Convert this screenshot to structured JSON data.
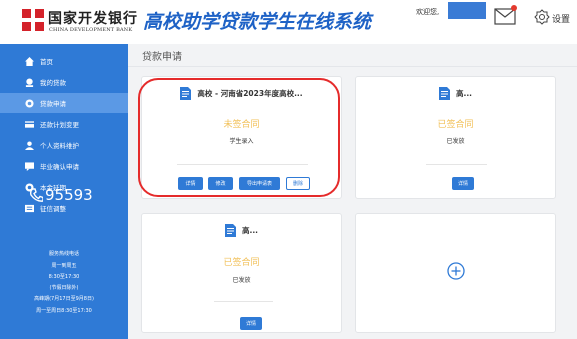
{
  "header": {
    "bank_name_cn": "国家开发银行",
    "bank_name_en": "CHINA DEVELOPMENT BANK",
    "system_title": "高校助学贷款学生在线系统",
    "welcome": "欢迎您,",
    "settings_label": "设置"
  },
  "sidebar": {
    "items": [
      {
        "label": "首页",
        "icon": "home-icon"
      },
      {
        "label": "我的贷款",
        "icon": "coin-icon"
      },
      {
        "label": "贷款申请",
        "icon": "apply-icon",
        "active": true
      },
      {
        "label": "还款计划变更",
        "icon": "card-icon"
      },
      {
        "label": "个人资料维护",
        "icon": "user-icon"
      },
      {
        "label": "毕业确认申请",
        "icon": "chat-icon"
      },
      {
        "label": "本金延期",
        "icon": "clock-icon"
      },
      {
        "label": "征信调整",
        "icon": "list-icon"
      }
    ],
    "hotline": "95593",
    "service_lines": [
      "服务热线电话",
      "周一到周五",
      "8:30至17:30",
      "(节假日除外)",
      "高峰期(7月17日至9月8日)",
      "周一至周日8:30至17:30"
    ]
  },
  "main": {
    "page_title": "贷款申请",
    "cards": [
      {
        "name": "高校 - 河南省2023年度高校...",
        "status": "未签合同",
        "sub_status": "学生录入",
        "buttons": [
          "详情",
          "修改",
          "导出申请表",
          "删除"
        ]
      },
      {
        "name": "高...",
        "status": "已签合同",
        "sub_status": "已发放",
        "buttons": [
          "详情"
        ]
      },
      {
        "name": "高...",
        "status": "已签合同",
        "sub_status": "已发放",
        "buttons": [
          "详情"
        ]
      }
    ]
  },
  "colors": {
    "primary": "#2f7ad6",
    "title_blue": "#1e62c6",
    "status_yellow": "#f2c15a",
    "highlight_red": "#e52b2b",
    "logo_red": "#d4222a"
  }
}
